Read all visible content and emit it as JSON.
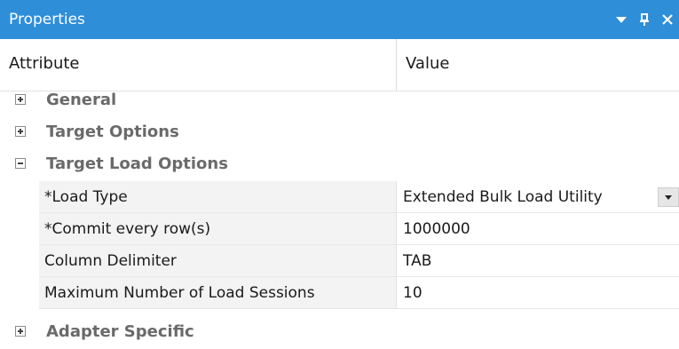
{
  "window": {
    "title": "Properties",
    "controls": {
      "dropdown_icon": "chevron-down-icon",
      "pin_icon": "pin-icon",
      "close_icon": "close-icon"
    }
  },
  "header": {
    "attribute": "Attribute",
    "value": "Value"
  },
  "categories": [
    {
      "label": "General",
      "expanded": false
    },
    {
      "label": "Target Options",
      "expanded": false
    },
    {
      "label": "Target Load Options",
      "expanded": true
    },
    {
      "label": "Adapter Specific",
      "expanded": false
    }
  ],
  "properties": [
    {
      "name": "*Load Type",
      "value": "Extended Bulk Load Utility",
      "has_dropdown": true
    },
    {
      "name": "*Commit every row(s)",
      "value": "1000000"
    },
    {
      "name": "Column Delimiter",
      "value": "TAB"
    },
    {
      "name": "Maximum Number of Load Sessions",
      "value": "10"
    }
  ],
  "colors": {
    "titlebar": "#2e8ed8",
    "category_text": "#6a6a6a",
    "attr_background": "#f3f3f3"
  }
}
